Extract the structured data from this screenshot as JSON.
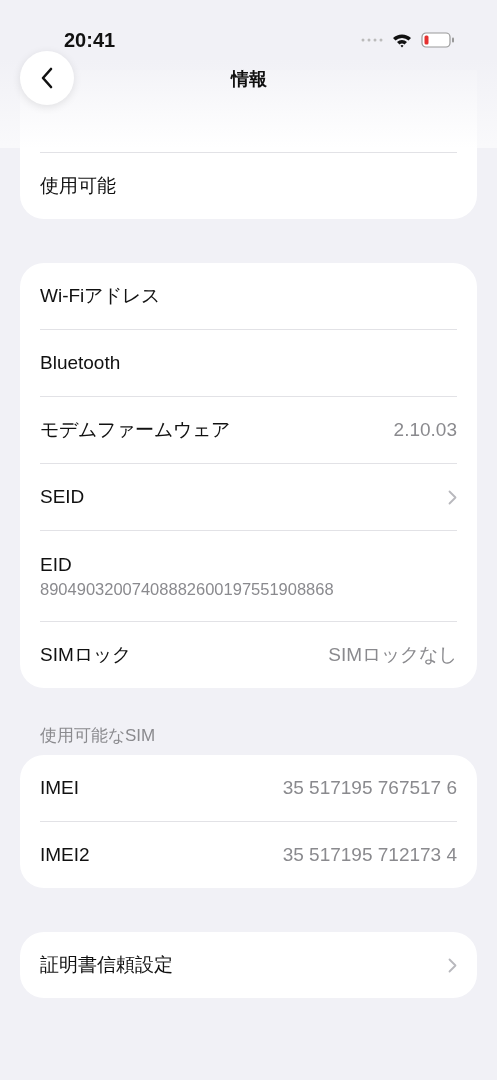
{
  "status_bar": {
    "time": "20:41"
  },
  "nav": {
    "title": "情報"
  },
  "top_card": {
    "rows": [
      {
        "label": "使用可能"
      }
    ]
  },
  "groups": [
    {
      "rows": [
        {
          "kind": "plain",
          "label": "Wi-Fiアドレス"
        },
        {
          "kind": "plain",
          "label": "Bluetooth"
        },
        {
          "kind": "value",
          "label": "モデムファームウェア",
          "value": "2.10.03"
        },
        {
          "kind": "link",
          "label": "SEID"
        },
        {
          "kind": "stacked",
          "label": "EID",
          "value": "89049032007408882600197551908868"
        },
        {
          "kind": "value",
          "label": "SIMロック",
          "value": "SIMロックなし"
        }
      ]
    },
    {
      "header": "使用可能なSIM",
      "rows": [
        {
          "kind": "value",
          "label": "IMEI",
          "value": "35 517195 767517 6"
        },
        {
          "kind": "value",
          "label": "IMEI2",
          "value": "35 517195 712173 4"
        }
      ]
    },
    {
      "rows": [
        {
          "kind": "link",
          "label": "証明書信頼設定"
        }
      ]
    }
  ]
}
